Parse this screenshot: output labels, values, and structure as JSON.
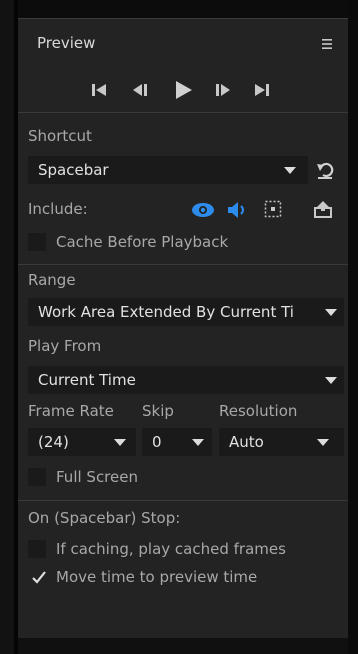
{
  "panel": {
    "title": "Preview"
  },
  "shortcut": {
    "label": "Shortcut",
    "value": "Spacebar"
  },
  "include": {
    "label": "Include:"
  },
  "cache_before_playback": {
    "label": "Cache Before Playback",
    "checked": false
  },
  "range": {
    "label": "Range",
    "value": "Work Area Extended By Current Ti"
  },
  "play_from": {
    "label": "Play From",
    "value": "Current Time"
  },
  "frame_rate": {
    "label": "Frame Rate",
    "value": "(24)"
  },
  "skip": {
    "label": "Skip",
    "value": "0"
  },
  "resolution": {
    "label": "Resolution",
    "value": "Auto"
  },
  "full_screen": {
    "label": "Full Screen",
    "checked": false
  },
  "on_stop": {
    "label": "On (Spacebar) Stop:",
    "if_caching_label": "If caching, play cached frames",
    "if_caching_checked": false,
    "move_time_label": "Move time to preview time",
    "move_time_checked": true
  },
  "colors": {
    "accent": "#2d8ceb",
    "panel_bg": "#232323",
    "field_bg": "#1a1a1a"
  },
  "icons": {
    "menu": "hamburger-menu-icon",
    "first_frame": "first-frame-icon",
    "prev_frame": "previous-frame-icon",
    "play": "play-icon",
    "next_frame": "next-frame-icon",
    "last_frame": "last-frame-icon",
    "reset": "reset-icon",
    "video": "eye-icon",
    "audio": "speaker-icon",
    "overlays": "overlay-bounds-icon",
    "export": "export-icon"
  }
}
